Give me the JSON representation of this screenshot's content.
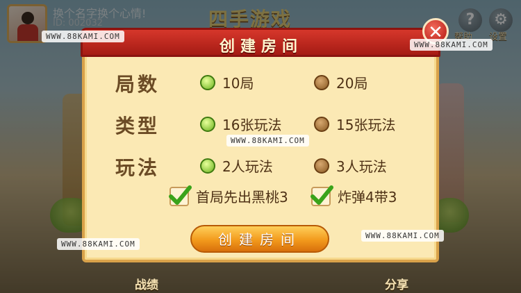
{
  "user": {
    "name": "换个名字换个心情!",
    "id": "ID: 002032"
  },
  "title": "四手游戏",
  "top_icons": [
    {
      "label": "帮助",
      "icon": "help-icon",
      "glyph": "?"
    },
    {
      "label": "设置",
      "icon": "gear-icon",
      "glyph": "⚙"
    }
  ],
  "dialog": {
    "title": "创建房间",
    "rows": [
      {
        "label": "局数",
        "options": [
          {
            "text": "10局",
            "selected": true
          },
          {
            "text": "20局",
            "selected": false
          }
        ]
      },
      {
        "label": "类型",
        "options": [
          {
            "text": "16张玩法",
            "selected": true
          },
          {
            "text": "15张玩法",
            "selected": false
          }
        ]
      },
      {
        "label": "玩法",
        "options": [
          {
            "text": "2人玩法",
            "selected": true
          },
          {
            "text": "3人玩法",
            "selected": false
          }
        ]
      }
    ],
    "checks": [
      {
        "text": "首局先出黑桃3",
        "checked": true
      },
      {
        "text": "炸弹4带3",
        "checked": true
      }
    ],
    "create_button": "创建房间",
    "close_glyph": "✕"
  },
  "bottom_nav": [
    {
      "label": "战绩"
    },
    {
      "label": "分享"
    }
  ],
  "watermark": "WWW.88KAMI.COM",
  "colors": {
    "accent_red": "#c52a1f",
    "button_orange": "#f29a1c",
    "panel": "#fbe9b4",
    "selected_green": "#6ab21e"
  }
}
